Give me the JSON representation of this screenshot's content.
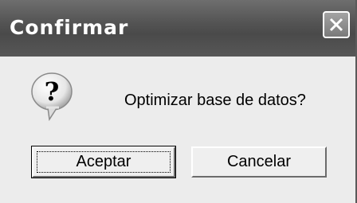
{
  "dialog": {
    "title": "Confirmar",
    "message": "Optimizar base de datos?",
    "icon": "question-icon"
  },
  "buttons": {
    "accept_label": "Aceptar",
    "cancel_label": "Cancelar",
    "close_icon": "close-icon"
  },
  "colors": {
    "titlebar": "#575757",
    "background": "#ececec",
    "title_text": "#ffffff"
  }
}
